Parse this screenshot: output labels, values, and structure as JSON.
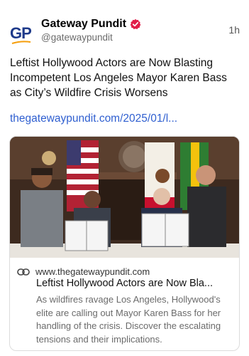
{
  "post": {
    "author_name": "Gateway Pundit",
    "handle": "@gatewaypundit",
    "time": "1h",
    "text": "Leftist Hollywood Actors are Now Blasting Incompetent Los Angeles Mayor Karen Bass as City’s Wildfire Crisis Worsens",
    "link_text": "thegatewaypundit.com/2025/01/l...",
    "avatar_text": "GP"
  },
  "card": {
    "domain": "www.thegatewaypundit.com",
    "title": "Leftist Hollywood Actors are Now Bla...",
    "description": "As wildfires ravage Los Angeles, Hollywood's elite are calling out Mayor Karen Bass for her handling of the crisis. Discover the escalating tensions and their implications."
  },
  "colors": {
    "brand_blue": "#1e3a8a",
    "swoosh_orange": "#f59e0b",
    "verified_badge": "#e11d48",
    "link_blue": "#2f5fd0"
  },
  "icons": {
    "verified": "verified-badge-icon",
    "link": "link-icon"
  }
}
